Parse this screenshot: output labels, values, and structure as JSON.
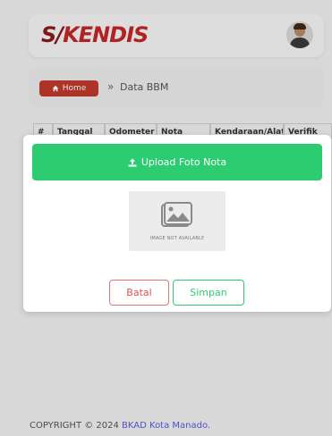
{
  "header": {
    "logo_part1": "S/",
    "logo_part2": "KENDIS"
  },
  "breadcrumb": {
    "home_label": "Home",
    "separator": "»",
    "current": "Data BBM"
  },
  "table": {
    "columns": [
      "#",
      "Tanggal",
      "Odometer",
      "Nota",
      "Kendaraan/Alat",
      "Verifik"
    ]
  },
  "modal": {
    "upload_label": "Upload Foto Nota",
    "image_placeholder_caption": "IMAGE NOT AVAILABLE",
    "cancel_label": "Batal",
    "save_label": "Simpan"
  },
  "footer": {
    "copyright_prefix": "COPYRIGHT © 2024 ",
    "link_text": "BKAD Kota Manado."
  },
  "colors": {
    "brand_red": "#c62828",
    "success_green": "#2ecc71",
    "danger": "#d9534f",
    "link": "#5b5be0"
  },
  "icons": {
    "home": "home-icon",
    "upload": "upload-icon",
    "image": "image-placeholder-icon",
    "avatar": "user-avatar"
  }
}
